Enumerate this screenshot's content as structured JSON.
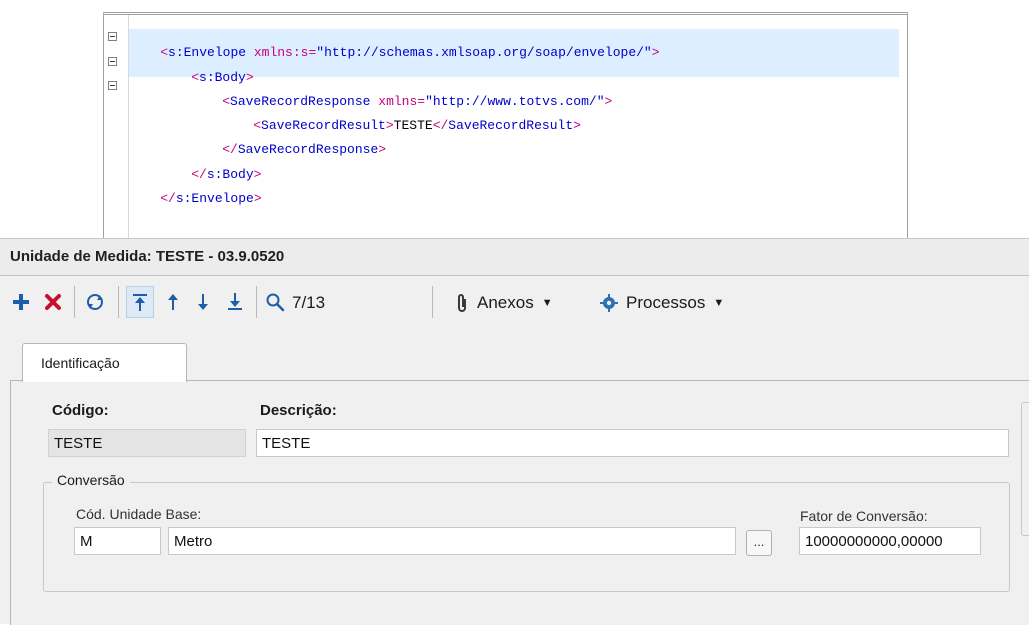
{
  "xml": {
    "line1": {
      "open": "<",
      "tag": "s:Envelope",
      "attr": " xmlns:s=",
      "value": "\"http://schemas.xmlsoap.org/soap/envelope/\"",
      "close": ">"
    },
    "line2": {
      "open": "<",
      "tag": "s:Body",
      "close": ">"
    },
    "line3": {
      "open": "<",
      "tag": "SaveRecordResponse",
      "attr": " xmlns=",
      "value": "\"http://www.totvs.com/\"",
      "close": ">"
    },
    "line4": {
      "open": "<",
      "tag": "SaveRecordResult",
      "close": ">",
      "text": "TESTE",
      "endopen": "</",
      "endtag": "SaveRecordResult",
      "endclose": ">"
    },
    "line5": {
      "open": "</",
      "tag": "SaveRecordResponse",
      "close": ">"
    },
    "line6": {
      "open": "</",
      "tag": "s:Body",
      "close": ">"
    },
    "line7": {
      "open": "</",
      "tag": "s:Envelope",
      "close": ">"
    }
  },
  "window": {
    "title": "Unidade de Medida: TESTE - 03.9.0520"
  },
  "toolbar": {
    "add_icon": "plus-icon",
    "delete_icon": "x-icon",
    "refresh_icon": "refresh-icon",
    "first_icon": "first-record-icon",
    "prev_icon": "arrow-up-icon",
    "next_icon": "arrow-down-icon",
    "last_icon": "last-record-icon",
    "search_icon": "search-icon",
    "record_counter": "7/13",
    "attachments_label": "Anexos",
    "processes_label": "Processos"
  },
  "tabs": [
    {
      "label": "Identificação",
      "active": true
    }
  ],
  "form": {
    "codigo_label": "Código:",
    "codigo_value": "TESTE",
    "descricao_label": "Descrição:",
    "descricao_value": "TESTE",
    "conversao_group": "Conversão",
    "cod_unidade_base_label": "Cód. Unidade Base:",
    "cod_unidade_base_value": "M",
    "unidade_base_desc": "Metro",
    "lookup_button": "...",
    "fator_label": "Fator de Conversão:",
    "fator_value": "10000000000,00000"
  },
  "colors": {
    "accent_blue": "#1c5fa8",
    "delete_red": "#c8102e",
    "add_blue": "#1c5fa8",
    "xml_tag": "#c8007a",
    "xml_name": "#0000cc"
  }
}
